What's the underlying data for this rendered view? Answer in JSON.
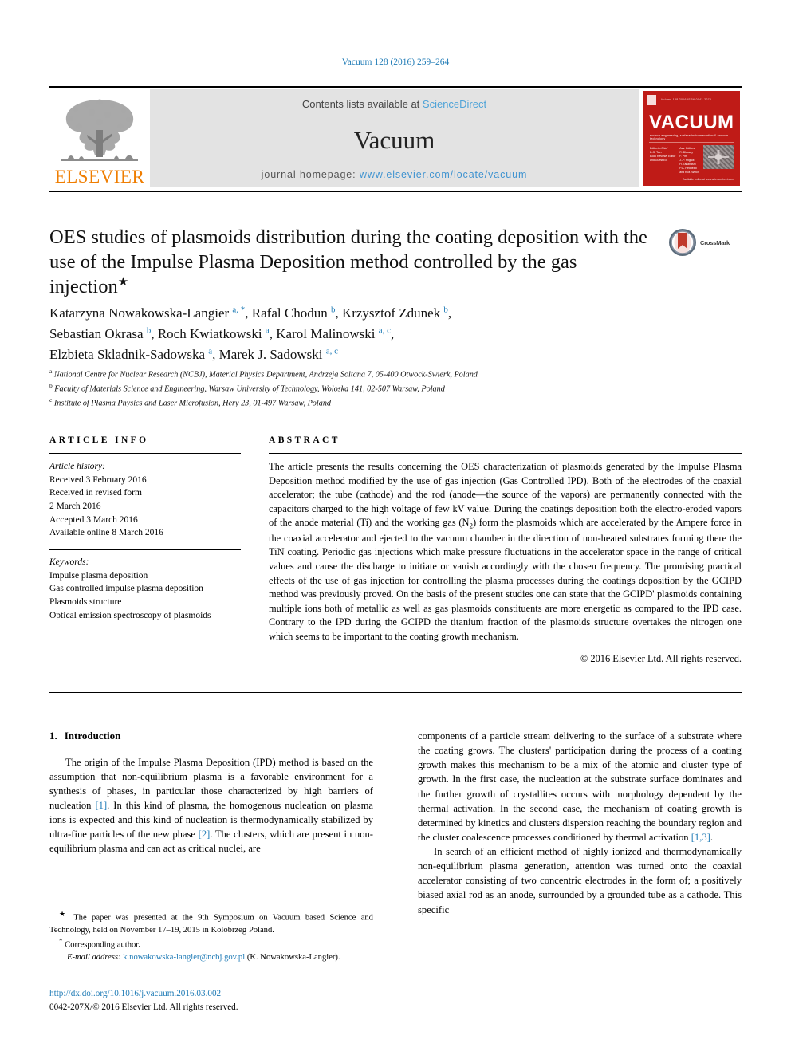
{
  "running_head": "Vacuum 128 (2016) 259–264",
  "masthead": {
    "publisher_name": "ELSEVIER",
    "contents_prefix": "Contents lists available at ",
    "sciencedirect": "ScienceDirect",
    "journal_name": "Vacuum",
    "homepage_prefix": "journal homepage: ",
    "homepage_url": "www.elsevier.com/locate/vacuum",
    "cover": {
      "title": "VACUUM",
      "subtitle": "surface engineering, surface instrumentation & vacuum technology",
      "issue_line": "Volume 128  2016  ISSN 0042-207X",
      "col_left": "Editor-in-Chief\nD.G. Teer\nBook Reviews Editor\nand Guest Ed.",
      "col_right": "Ass. Editors\nR. Blossey\nF. Pirri\nJ.-P. Mignot\nH. Takahashi\nP.A. Redhead\nand K.M. Welch",
      "footer": "Available online at www.sciencedirect.com"
    }
  },
  "title": {
    "text": "OES studies of plasmoids distribution during the coating deposition with the use of the Impulse Plasma Deposition method controlled by the gas injection",
    "star": "★",
    "crossmark_label": "CrossMark"
  },
  "authors": {
    "line1_a": "Katarzyna Nowakowska-Langier ",
    "line1_sup1": "a, *",
    "line1_b": ", Rafal Chodun ",
    "line1_sup2": "b",
    "line1_c": ", Krzysztof Zdunek ",
    "line1_sup3": "b",
    "line1_d": ",",
    "line2_a": "Sebastian Okrasa ",
    "line2_sup1": "b",
    "line2_b": ", Roch Kwiatkowski ",
    "line2_sup2": "a",
    "line2_c": ", Karol Malinowski ",
    "line2_sup3": "a, c",
    "line2_d": ",",
    "line3_a": "Elzbieta Skladnik-Sadowska ",
    "line3_sup1": "a",
    "line3_b": ", Marek J. Sadowski ",
    "line3_sup2": "a, c"
  },
  "affiliations": [
    {
      "mark": "a",
      "text": "National Centre for Nuclear Research (NCBJ), Material Physics Department, Andrzeja Soltana 7, 05-400 Otwock-Swierk, Poland"
    },
    {
      "mark": "b",
      "text": "Faculty of Materials Science and Engineering, Warsaw University of Technology, Woloska 141, 02-507 Warsaw, Poland"
    },
    {
      "mark": "c",
      "text": "Institute of Plasma Physics and Laser Microfusion, Hery 23, 01-497 Warsaw, Poland"
    }
  ],
  "article_info": {
    "heading": "ARTICLE INFO",
    "history_label": "Article history:",
    "history": [
      "Received 3 February 2016",
      "Received in revised form",
      "2 March 2016",
      "Accepted 3 March 2016",
      "Available online 8 March 2016"
    ],
    "keywords_label": "Keywords:",
    "keywords": [
      "Impulse plasma deposition",
      "Gas controlled impulse plasma deposition",
      "Plasmoids structure",
      "Optical emission spectroscopy of plasmoids"
    ]
  },
  "abstract": {
    "heading": "ABSTRACT",
    "part1": "The article presents the results concerning the OES characterization of plasmoids generated by the Impulse Plasma Deposition method modified by the use of gas injection (Gas Controlled IPD). Both of the electrodes of the coaxial accelerator; the tube (cathode) and the rod (anode—the source of the vapors) are permanently connected with the capacitors charged to the high voltage of few kV value. During the coatings deposition both the electro-eroded vapors of the anode material (Ti) and the working gas (N",
    "sub1": "2",
    "part2": ") form the plasmoids which are accelerated by the Ampere force in the coaxial accelerator and ejected to the vacuum chamber in the direction of non-heated substrates forming there the TiN coating. Periodic gas injections which make pressure fluctuations in the accelerator space in the range of critical values and cause the discharge to initiate or vanish accordingly with the chosen frequency. The promising practical effects of the use of gas injection for controlling the plasma processes during the coatings deposition by the GCIPD method was previously proved. On the basis of the present studies one can state that the GCIPD' plasmoids containing multiple ions both of metallic as well as gas plasmoids constituents are more energetic as compared to the IPD case. Contrary to the IPD during the GCIPD the titanium fraction of the plasmoids structure overtakes the nitrogen one which seems to be important to the coating growth mechanism.",
    "copyright": "© 2016 Elsevier Ltd. All rights reserved."
  },
  "body": {
    "section_number": "1.",
    "section_title": "Introduction",
    "left_p1_a": "The origin of the Impulse Plasma Deposition (IPD) method is based on the assumption that non-equilibrium plasma is a favorable environment for a synthesis of phases, in particular those characterized by high barriers of nucleation ",
    "left_ref1": "[1]",
    "left_p1_b": ". In this kind of plasma, the homogenous nucleation on plasma ions is expected and this kind of nucleation is thermodynamically stabilized by ultra-fine particles of the new phase ",
    "left_ref2": "[2]",
    "left_p1_c": ". The clusters, which are present in non-equilibrium plasma and can act as critical nuclei, are",
    "right_p1_a": "components of a particle stream delivering to the surface of a substrate where the coating grows. The clusters' participation during the process of a coating growth makes this mechanism to be a mix of the atomic and cluster type of growth. In the first case, the nucleation at the substrate surface dominates and the further growth of crystallites occurs with morphology dependent by the thermal activation. In the second case, the mechanism of coating growth is determined by kinetics and clusters dispersion reaching the boundary region and the cluster coalescence processes conditioned by thermal activation ",
    "right_ref1": "[1,3]",
    "right_p1_b": ".",
    "right_p2": "In search of an efficient method of highly ionized and thermodynamically non-equilibrium plasma generation, attention was turned onto the coaxial accelerator consisting of two concentric electrodes in the form of; a positively biased axial rod as an anode, surrounded by a grounded tube as a cathode. This specific"
  },
  "footnotes": {
    "fn1_mark": "★",
    "fn1_text": "The paper was presented at the 9th Symposium on Vacuum based Science and Technology, held on November 17–19, 2015 in Kolobrzeg Poland.",
    "fn2_mark": "*",
    "fn2_text": "Corresponding author.",
    "email_label": "E-mail address:",
    "email": "k.nowakowska-langier@ncbj.gov.pl",
    "email_owner": "(K. Nowakowska-Langier)."
  },
  "doi": {
    "url": "http://dx.doi.org/10.1016/j.vacuum.2016.03.002",
    "issn_line": "0042-207X/© 2016 Elsevier Ltd. All rights reserved."
  },
  "colors": {
    "link": "#1f7bb6",
    "sciencedirect": "#4ea3d8",
    "elsevier_orange": "#ef7d00",
    "cover_red": "#bf1b17"
  }
}
